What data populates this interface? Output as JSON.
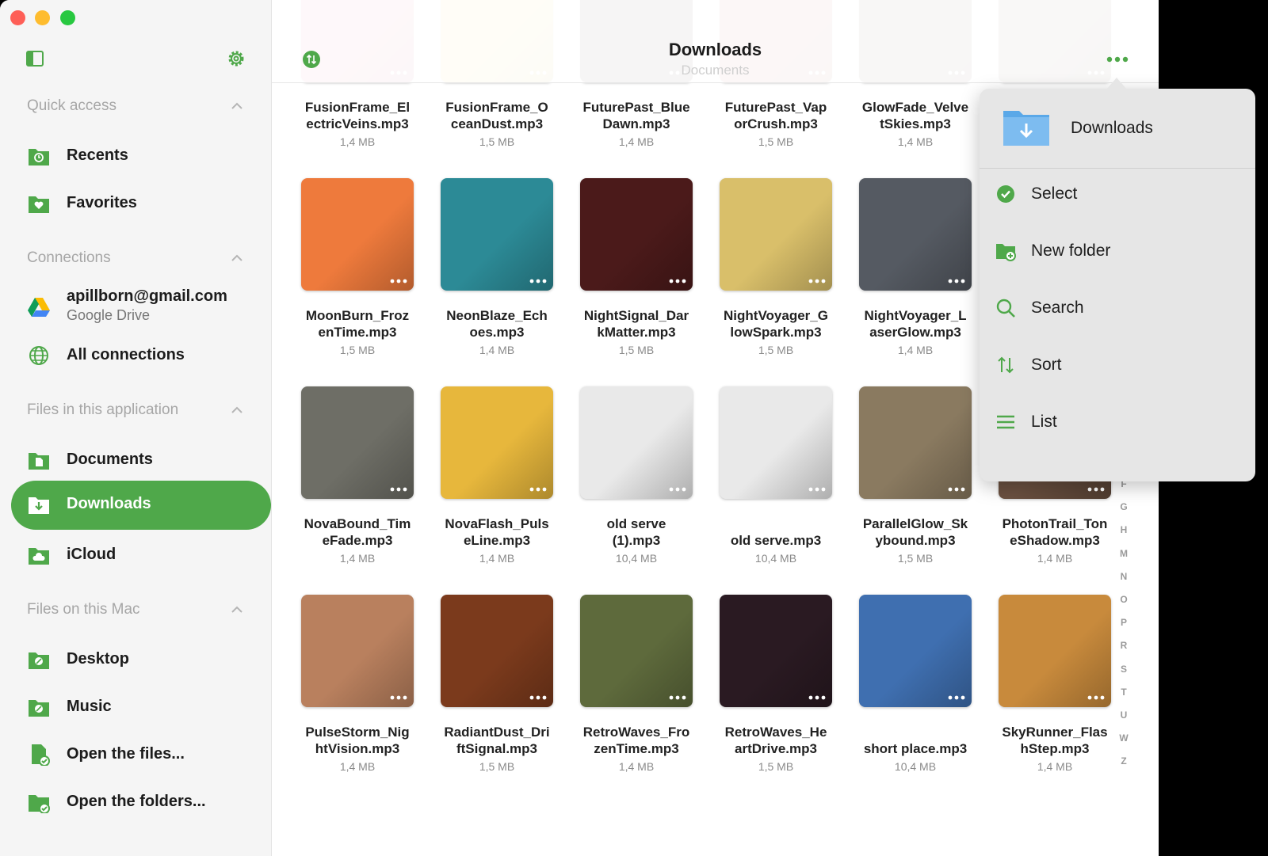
{
  "sidebar": {
    "quick_access_title": "Quick access",
    "recents": "Recents",
    "favorites": "Favorites",
    "connections_title": "Connections",
    "account_email": "apillborn@gmail.com",
    "account_service": "Google Drive",
    "all_connections": "All connections",
    "app_files_title": "Files in this application",
    "documents": "Documents",
    "downloads": "Downloads",
    "icloud": "iCloud",
    "mac_files_title": "Files on this Mac",
    "desktop": "Desktop",
    "music": "Music",
    "open_files": "Open the files...",
    "open_folders": "Open the folders..."
  },
  "header": {
    "title": "Downloads",
    "subtitle": "Documents"
  },
  "files": [
    {
      "line1": "FusionFrame_El",
      "line2": "ectricVeins.mp3",
      "size": "1,4 MB",
      "color": "#e5507b"
    },
    {
      "line1": "FusionFrame_O",
      "line2": "ceanDust.mp3",
      "size": "1,5 MB",
      "color": "#f0cf38"
    },
    {
      "line1": "FuturePast_Blue",
      "line2": "Dawn.mp3",
      "size": "1,4 MB",
      "color": "#2a1410"
    },
    {
      "line1": "FuturePast_Vap",
      "line2": "orCrush.mp3",
      "size": "1,5 MB",
      "color": "#b4423a"
    },
    {
      "line1": "GlowFade_Velve",
      "line2": "tSkies.mp3",
      "size": "1,4 MB",
      "color": "#5b3a2a"
    },
    {
      "line1": "",
      "line2": "",
      "size": "",
      "color": "#6b4a36"
    },
    {
      "line1": "MoonBurn_Froz",
      "line2": "enTime.mp3",
      "size": "1,5 MB",
      "color": "#ee7a3c"
    },
    {
      "line1": "NeonBlaze_Ech",
      "line2": "oes.mp3",
      "size": "1,4 MB",
      "color": "#2c8a96"
    },
    {
      "line1": "NightSignal_Dar",
      "line2": "kMatter.mp3",
      "size": "1,5 MB",
      "color": "#4b1a1a"
    },
    {
      "line1": "NightVoyager_G",
      "line2": "lowSpark.mp3",
      "size": "1,5 MB",
      "color": "#d9bf6a"
    },
    {
      "line1": "NightVoyager_L",
      "line2": "aserGlow.mp3",
      "size": "1,4 MB",
      "color": "#555a62"
    },
    {
      "line1": "",
      "line2": "",
      "size": "",
      "color": "#7a5a44"
    },
    {
      "line1": "NovaBound_Tim",
      "line2": "eFade.mp3",
      "size": "1,4 MB",
      "color": "#6e6e66"
    },
    {
      "line1": "NovaFlash_Puls",
      "line2": "eLine.mp3",
      "size": "1,4 MB",
      "color": "#e7b73c"
    },
    {
      "line1": "old serve",
      "line2": "(1).mp3",
      "size": "10,4 MB",
      "color": "#e9e9e9"
    },
    {
      "line1": "",
      "line2": "old serve.mp3",
      "size": "10,4 MB",
      "color": "#e9e9e9"
    },
    {
      "line1": "ParallelGlow_Sk",
      "line2": "ybound.mp3",
      "size": "1,5 MB",
      "color": "#8a7a60"
    },
    {
      "line1": "PhotonTrail_Ton",
      "line2": "eShadow.mp3",
      "size": "1,4 MB",
      "color": "#6a5040"
    },
    {
      "line1": "PulseStorm_Nig",
      "line2": "htVision.mp3",
      "size": "1,4 MB",
      "color": "#b9805e"
    },
    {
      "line1": "RadiantDust_Dri",
      "line2": "ftSignal.mp3",
      "size": "1,5 MB",
      "color": "#7b3a1c"
    },
    {
      "line1": "RetroWaves_Fro",
      "line2": "zenTime.mp3",
      "size": "1,4 MB",
      "color": "#5e6a3c"
    },
    {
      "line1": "RetroWaves_He",
      "line2": "artDrive.mp3",
      "size": "1,5 MB",
      "color": "#2a1a22"
    },
    {
      "line1": "",
      "line2": "short place.mp3",
      "size": "10,4 MB",
      "color": "#3f6fb0"
    },
    {
      "line1": "SkyRunner_Flas",
      "line2": "hStep.mp3",
      "size": "1,4 MB",
      "color": "#c88a3c"
    }
  ],
  "alphabet": [
    "F",
    "G",
    "H",
    "M",
    "N",
    "O",
    "P",
    "R",
    "S",
    "T",
    "U",
    "W",
    "Z"
  ],
  "popover": {
    "title": "Downloads",
    "select": "Select",
    "new_folder": "New folder",
    "search": "Search",
    "sort": "Sort",
    "list": "List"
  },
  "colors": {
    "accent": "#4fa84a",
    "folder_blue": "#5aa8e8"
  }
}
